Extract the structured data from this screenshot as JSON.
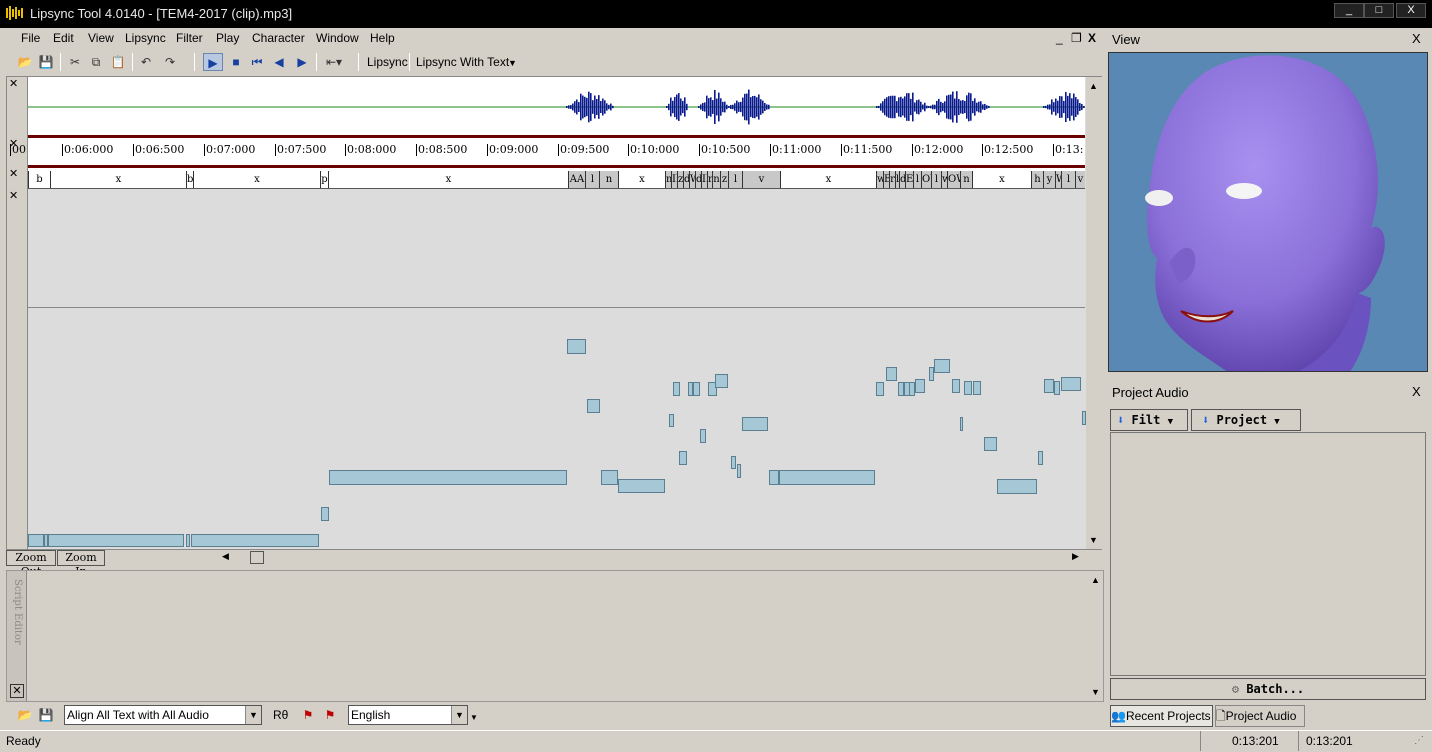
{
  "window": {
    "title": "Lipsync Tool 4.0140 - [TEM4-2017 (clip).mp3]",
    "min": "_",
    "max": "□",
    "close": "X"
  },
  "menu": [
    "File",
    "Edit",
    "View",
    "Lipsync",
    "Filter",
    "Play",
    "Character",
    "Window",
    "Help"
  ],
  "mdi_controls": {
    "min": "_",
    "restore": "❐",
    "close": "X"
  },
  "toolbar": {
    "lipsync_label": "Lipsync",
    "lipsync_with_text_label": "Lipsync With Text"
  },
  "ruler_ticks": [
    "00",
    "0:06:000",
    "0:06:500",
    "0:07:000",
    "0:07:500",
    "0:08:000",
    "0:08:500",
    "0:09:000",
    "0:09:500",
    "0:10:000",
    "0:10:500",
    "0:11:000",
    "0:11:500",
    "0:12:000",
    "0:12:500",
    "0:13:"
  ],
  "phonemes": [
    {
      "t": "b",
      "g": false
    },
    {
      "t": "x",
      "g": false
    },
    {
      "t": "b",
      "g": false
    },
    {
      "t": "x",
      "g": false
    },
    {
      "t": "p",
      "g": false
    },
    {
      "t": "x",
      "g": false
    },
    {
      "t": "AA",
      "g": true
    },
    {
      "t": "l",
      "g": true
    },
    {
      "t": "n",
      "g": true
    },
    {
      "t": "x",
      "g": false
    },
    {
      "t": "m",
      "g": true
    },
    {
      "t": "IH",
      "g": true
    },
    {
      "t": "z",
      "g": true
    },
    {
      "t": "d",
      "g": true
    },
    {
      "t": "W",
      "g": true
    },
    {
      "t": "d",
      "g": true
    },
    {
      "t": "IH",
      "g": true
    },
    {
      "t": "r",
      "g": true
    },
    {
      "t": "n",
      "g": true
    },
    {
      "t": "z",
      "g": true
    },
    {
      "t": "l",
      "g": true
    },
    {
      "t": "v",
      "g": true
    },
    {
      "t": "x",
      "g": false
    },
    {
      "t": "w",
      "g": true
    },
    {
      "t": "EH",
      "g": true
    },
    {
      "t": "r",
      "g": true
    },
    {
      "t": "l",
      "g": true
    },
    {
      "t": "d",
      "g": true
    },
    {
      "t": "ER",
      "g": true
    },
    {
      "t": "l",
      "g": true
    },
    {
      "t": "OW",
      "g": true
    },
    {
      "t": "l",
      "g": true
    },
    {
      "t": "w",
      "g": true
    },
    {
      "t": "OW",
      "g": true
    },
    {
      "t": "n",
      "g": true
    },
    {
      "t": "x",
      "g": false
    },
    {
      "t": "h",
      "g": true
    },
    {
      "t": "y",
      "g": true
    },
    {
      "t": "W",
      "g": true
    },
    {
      "t": "l",
      "g": true
    },
    {
      "t": "v",
      "g": true
    }
  ],
  "zoom": {
    "out": "Zoom Out",
    "in": "Zoom In"
  },
  "script_editor": {
    "label": "Script Editor"
  },
  "bottombar": {
    "align_mode": "Align All Text with All Audio",
    "rs_label": "Rθ",
    "language": "English"
  },
  "status": {
    "text": "Ready",
    "time1": "0:13:201",
    "time2": "0:13:201"
  },
  "view_panel": {
    "title": "View",
    "close": "X"
  },
  "audio_panel": {
    "title": "Project Audio",
    "close": "X",
    "filter_btn": "Filt",
    "project_btn": "Project",
    "batch_btn": "Batch...",
    "tab_recent": "Recent Projects",
    "tab_audio": "Project Audio"
  },
  "colors": {
    "titlebar": "#000000",
    "waveform": "#0a1a8c",
    "ruler_line": "#6b0000",
    "block": "#a6c8d6",
    "face": "#8a70d8",
    "view_bg": "#5a88b4"
  }
}
